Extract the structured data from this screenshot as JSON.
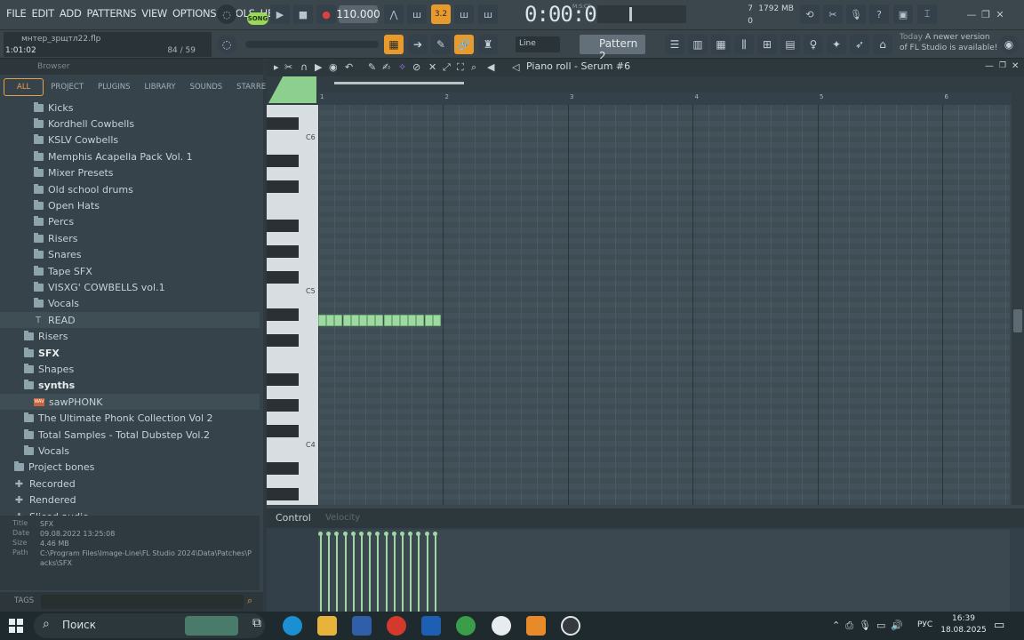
{
  "menu": [
    "FILE",
    "EDIT",
    "ADD",
    "PATTERNS",
    "VIEW",
    "OPTIONS",
    "TOOLS",
    "HELP"
  ],
  "transport": {
    "song_label": "SONG",
    "tempo": "110.000",
    "time": "0:00:00",
    "time_format": "M:S:CS",
    "snap": "3.2"
  },
  "cpu": {
    "value1": "7",
    "memory": "1792 MB",
    "value2": "0"
  },
  "project": {
    "file": "мнтер_зрщтл22.flp",
    "time": "1:01:02",
    "count": "84 / 59"
  },
  "toolbar2": {
    "line_mode": "Line",
    "pattern": "Pattern 2"
  },
  "news": {
    "today": "Today",
    "text": "A newer version of FL Studio is available!"
  },
  "browser": {
    "title": "Browser",
    "tabs": [
      "ALL",
      "PROJECT",
      "PLUGINS",
      "LIBRARY",
      "SOUNDS",
      "STARRED"
    ],
    "tree": [
      {
        "label": "Kicks",
        "indent": 2,
        "type": "folder"
      },
      {
        "label": "Kordhell Cowbells",
        "indent": 2,
        "type": "folder"
      },
      {
        "label": "KSLV Cowbells",
        "indent": 2,
        "type": "folder"
      },
      {
        "label": "Memphis Acapella Pack Vol. 1",
        "indent": 2,
        "type": "folder"
      },
      {
        "label": "Mixer Presets",
        "indent": 2,
        "type": "folder"
      },
      {
        "label": "Old school drums",
        "indent": 2,
        "type": "folder"
      },
      {
        "label": "Open Hats",
        "indent": 2,
        "type": "folder"
      },
      {
        "label": "Percs",
        "indent": 2,
        "type": "folder"
      },
      {
        "label": "Risers",
        "indent": 2,
        "type": "folder"
      },
      {
        "label": "Snares",
        "indent": 2,
        "type": "folder"
      },
      {
        "label": "Tape SFX",
        "indent": 2,
        "type": "folder"
      },
      {
        "label": "VISXG' COWBELLS vol.1",
        "indent": 2,
        "type": "folder"
      },
      {
        "label": "Vocals",
        "indent": 2,
        "type": "folder"
      },
      {
        "label": "READ",
        "indent": 2,
        "type": "text"
      },
      {
        "label": "Risers",
        "indent": 1,
        "type": "folder"
      },
      {
        "label": "SFX",
        "indent": 1,
        "type": "folder"
      },
      {
        "label": "Shapes",
        "indent": 1,
        "type": "folder"
      },
      {
        "label": "synths",
        "indent": 1,
        "type": "folder"
      },
      {
        "label": "sawPHONK",
        "indent": 2,
        "type": "wav"
      },
      {
        "label": "The Ultimate Phonk Collection Vol 2",
        "indent": 1,
        "type": "folder"
      },
      {
        "label": "Total Samples - Total Dubstep Vol.2",
        "indent": 1,
        "type": "folder"
      },
      {
        "label": "Vocals",
        "indent": 1,
        "type": "folder"
      },
      {
        "label": "Project bones",
        "indent": 0,
        "type": "folder"
      },
      {
        "label": "Recorded",
        "indent": 0,
        "type": "plus"
      },
      {
        "label": "Rendered",
        "indent": 0,
        "type": "plus"
      },
      {
        "label": "Sliced audio",
        "indent": 0,
        "type": "plus"
      }
    ],
    "info": {
      "title_label": "Title",
      "title": "SFX",
      "date_label": "Date",
      "date": "09.08.2022 13:25:08",
      "size_label": "Size",
      "size": "4.46 MB",
      "path_label": "Path",
      "path": "C:\\Program Files\\Image-Line\\FL Studio 2024\\Data\\Patches\\Packs\\SFX"
    },
    "tags_label": "TAGS"
  },
  "piano_roll": {
    "title": "Piano roll - Serum #6",
    "ruler": [
      "1",
      "2",
      "3",
      "4",
      "5",
      "6"
    ],
    "key_labels": [
      "C6",
      "C5",
      "C4"
    ],
    "note_count": 15,
    "control_label": "Control",
    "control_sub": "Velocity"
  },
  "taskbar": {
    "search": "Поиск",
    "lang": "РУС",
    "time": "16:39",
    "date": "18.08.2025"
  },
  "colors": {
    "accent": "#e89a2d",
    "note": "#9fd8a2",
    "song": "#9ad85a"
  }
}
